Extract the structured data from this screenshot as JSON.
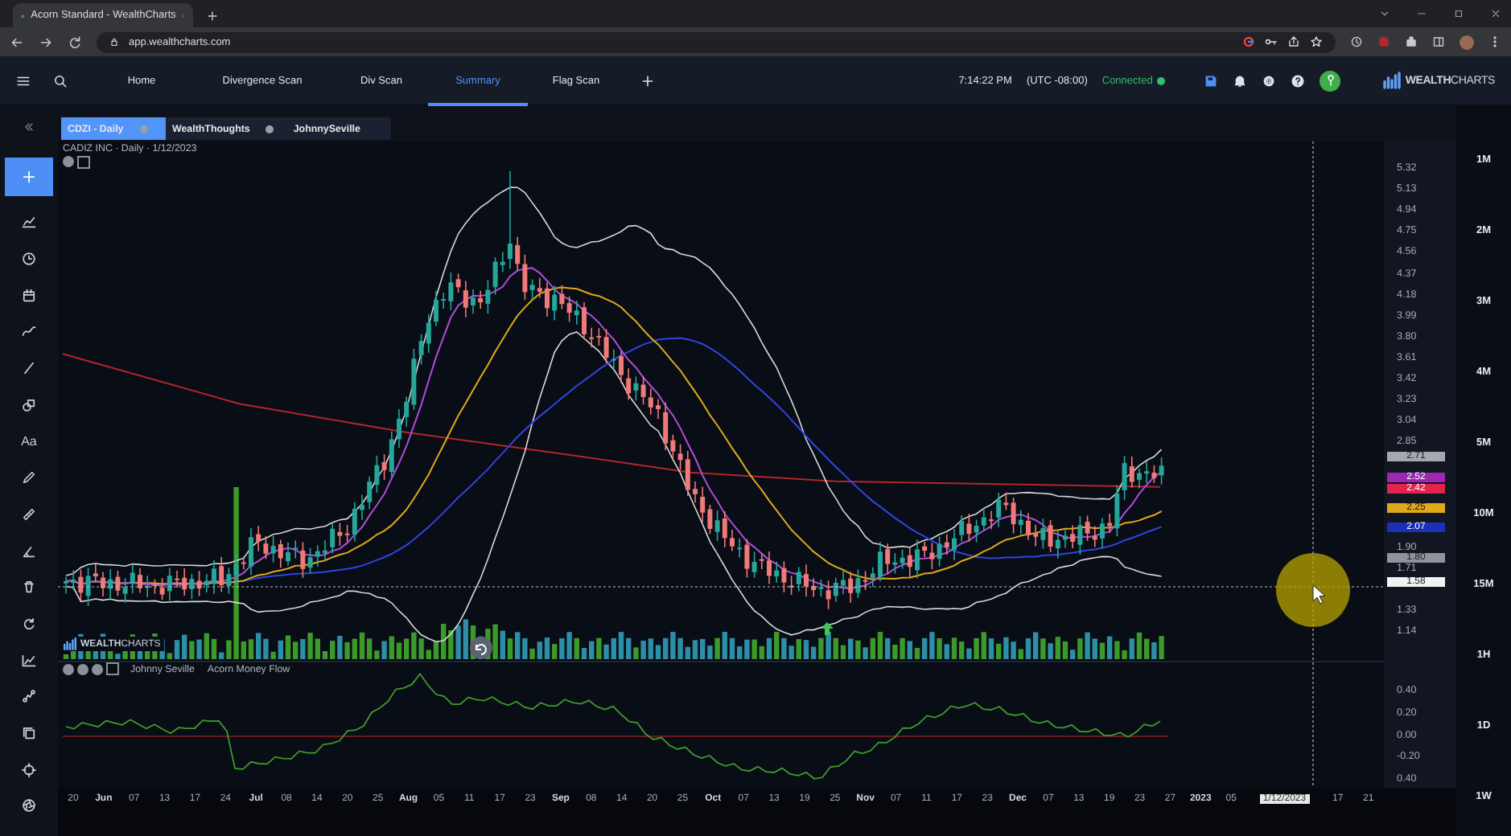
{
  "browser": {
    "tab_title": "Acorn Standard - WealthCharts",
    "url": "app.wealthcharts.com"
  },
  "header": {
    "nav": [
      {
        "label": "Home",
        "selected": false
      },
      {
        "label": "Divergence Scan",
        "selected": false
      },
      {
        "label": "Div Scan",
        "selected": false
      },
      {
        "label": "Summary",
        "selected": true
      },
      {
        "label": "Flag Scan",
        "selected": false
      }
    ],
    "time": "7:14:22 PM",
    "timezone": "(UTC -08:00)",
    "status": {
      "label": "Connected",
      "color": "#2fbf71"
    },
    "logo": "**WEALTH**CHARTS"
  },
  "toolbar": {
    "text_tool": "Aa"
  },
  "chart_tabs": [
    {
      "label": "CDZI - Daily",
      "selected": true,
      "dot": true
    },
    {
      "label": "WealthThoughts",
      "selected": false,
      "dot": true
    },
    {
      "label": "JohnnySeville",
      "selected": false,
      "dot": false
    }
  ],
  "chart": {
    "title": "CADIZ INC · Daily · 1/12/2023",
    "volume_logo": "**WEALTH**CHARTS",
    "price_ticks": [
      "5.32",
      "5.13",
      "4.94",
      "4.75",
      "4.56",
      "4.37",
      "4.18",
      "3.99",
      "3.80",
      "3.61",
      "3.42",
      "3.23",
      "3.04",
      "2.85",
      "1.90",
      "1.71",
      "1.33",
      "1.14"
    ],
    "price_badges": [
      {
        "text": "2.71",
        "color": "#a4a8b0"
      },
      {
        "text": "2.52",
        "color": "#9c27b0"
      },
      {
        "text": "2.42",
        "color": "#e3234f"
      },
      {
        "text": "2.25",
        "color": "#e0a81a"
      },
      {
        "text": "2.07",
        "color": "#1c2fb8"
      },
      {
        "text": "1.80",
        "color": "#8f939a"
      },
      {
        "text": "1.58",
        "color": "#f2f2f2"
      }
    ],
    "indicator": {
      "author": "Johnny Seville",
      "name": "Acorn Money Flow",
      "ticks": [
        "0.40",
        "0.20",
        "0.00",
        "-0.20",
        "0.40"
      ]
    },
    "x_labels": [
      {
        "text": "20",
        "kind": "tick"
      },
      {
        "text": "Jun",
        "kind": "month"
      },
      {
        "text": "07",
        "kind": "tick"
      },
      {
        "text": "13",
        "kind": "tick"
      },
      {
        "text": "17",
        "kind": "tick"
      },
      {
        "text": "24",
        "kind": "tick"
      },
      {
        "text": "Jul",
        "kind": "month"
      },
      {
        "text": "08",
        "kind": "tick"
      },
      {
        "text": "14",
        "kind": "tick"
      },
      {
        "text": "20",
        "kind": "tick"
      },
      {
        "text": "25",
        "kind": "tick"
      },
      {
        "text": "Aug",
        "kind": "month"
      },
      {
        "text": "05",
        "kind": "tick"
      },
      {
        "text": "11",
        "kind": "tick"
      },
      {
        "text": "17",
        "kind": "tick"
      },
      {
        "text": "23",
        "kind": "tick"
      },
      {
        "text": "Sep",
        "kind": "month"
      },
      {
        "text": "08",
        "kind": "tick"
      },
      {
        "text": "14",
        "kind": "tick"
      },
      {
        "text": "20",
        "kind": "tick"
      },
      {
        "text": "25",
        "kind": "tick"
      },
      {
        "text": "Oct",
        "kind": "month"
      },
      {
        "text": "07",
        "kind": "tick"
      },
      {
        "text": "13",
        "kind": "tick"
      },
      {
        "text": "19",
        "kind": "tick"
      },
      {
        "text": "25",
        "kind": "tick"
      },
      {
        "text": "Nov",
        "kind": "month"
      },
      {
        "text": "07",
        "kind": "tick"
      },
      {
        "text": "11",
        "kind": "tick"
      },
      {
        "text": "17",
        "kind": "tick"
      },
      {
        "text": "23",
        "kind": "tick"
      },
      {
        "text": "Dec",
        "kind": "month"
      },
      {
        "text": "07",
        "kind": "tick"
      },
      {
        "text": "13",
        "kind": "tick"
      },
      {
        "text": "19",
        "kind": "tick"
      },
      {
        "text": "23",
        "kind": "tick"
      },
      {
        "text": "27",
        "kind": "tick"
      },
      {
        "text": "2023",
        "kind": "month"
      },
      {
        "text": "05",
        "kind": "tick"
      },
      {
        "text": "1/12/2023",
        "kind": "cursor"
      },
      {
        "text": "17",
        "kind": "tick"
      },
      {
        "text": "21",
        "kind": "tick"
      }
    ]
  },
  "timeframes": [
    "1M",
    "2M",
    "3M",
    "4M",
    "5M",
    "10M",
    "15M",
    "1H",
    "1D",
    "1W"
  ]
}
